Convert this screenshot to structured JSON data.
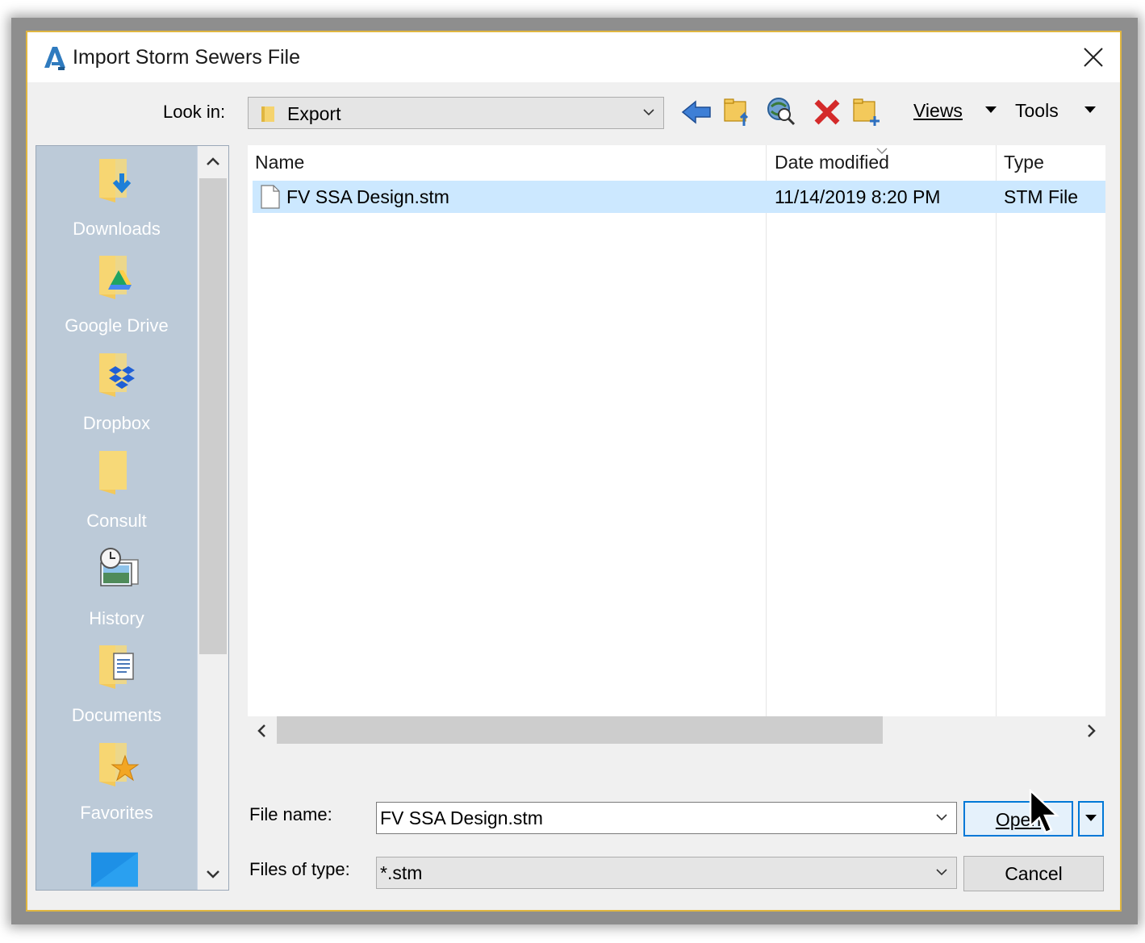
{
  "window": {
    "title": "Import Storm Sewers File",
    "app_icon": "autocad-civil-icon"
  },
  "toolbar": {
    "look_in_label": "Look in:",
    "look_in_value": "Export",
    "views_label": "Views",
    "tools_label": "Tools"
  },
  "places": [
    {
      "label": "Downloads",
      "icon": "downloads-folder-icon"
    },
    {
      "label": "Google Drive",
      "icon": "google-drive-folder-icon"
    },
    {
      "label": "Dropbox",
      "icon": "dropbox-folder-icon"
    },
    {
      "label": "Consult",
      "icon": "folder-icon"
    },
    {
      "label": "History",
      "icon": "history-icon"
    },
    {
      "label": "Documents",
      "icon": "documents-folder-icon"
    },
    {
      "label": "Favorites",
      "icon": "favorites-folder-icon"
    }
  ],
  "file_list": {
    "columns": [
      "Name",
      "Date modified",
      "Type"
    ],
    "rows": [
      {
        "name": "FV SSA Design.stm",
        "date": "11/14/2019 8:20 PM",
        "type": "STM File",
        "selected": true
      }
    ]
  },
  "footer": {
    "file_name_label": "File name:",
    "file_name_value": "FV SSA Design.stm",
    "file_type_label": "Files of type:",
    "file_type_value": "*.stm",
    "open_label": "Open",
    "cancel_label": "Cancel"
  },
  "colors": {
    "accent_border": "#e0b640",
    "selection": "#cce8ff",
    "places_bg": "#bccad8"
  }
}
